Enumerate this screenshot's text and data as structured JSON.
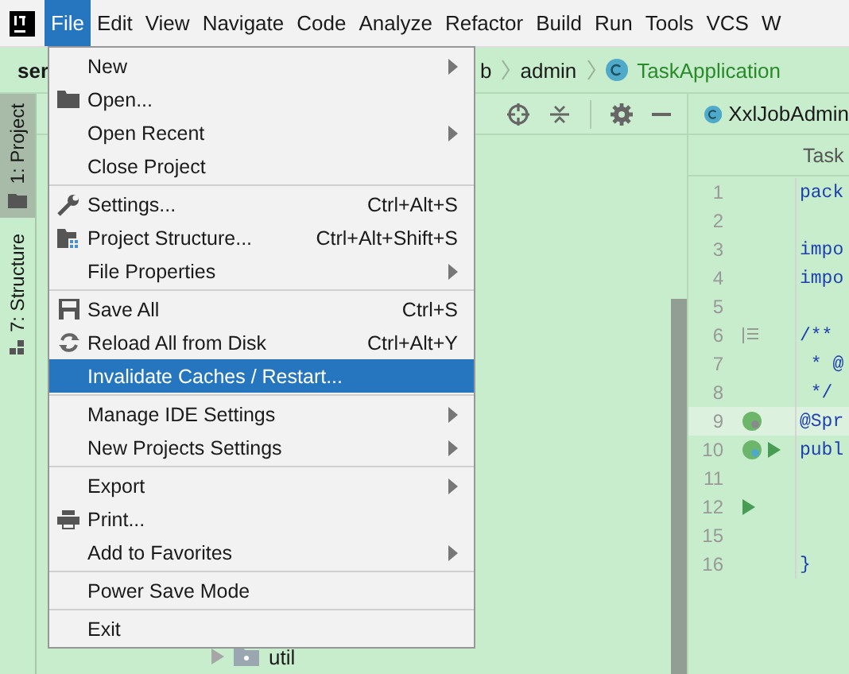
{
  "menu_bar": [
    {
      "label": "File",
      "selected": true
    },
    {
      "label": "Edit",
      "selected": false
    },
    {
      "label": "View",
      "selected": false
    },
    {
      "label": "Navigate",
      "selected": false
    },
    {
      "label": "Code",
      "selected": false
    },
    {
      "label": "Analyze",
      "selected": false
    },
    {
      "label": "Refactor",
      "selected": false
    },
    {
      "label": "Build",
      "selected": false
    },
    {
      "label": "Run",
      "selected": false
    },
    {
      "label": "Tools",
      "selected": false
    },
    {
      "label": "VCS",
      "selected": false
    },
    {
      "label": "W",
      "selected": false
    }
  ],
  "breadcrumb": {
    "project": "ser",
    "items": [
      "b",
      "admin"
    ],
    "class_name": "TaskApplication"
  },
  "tool_tabs": [
    {
      "label": "1: Project",
      "selected": true
    },
    {
      "label": "7: Structure",
      "selected": false
    }
  ],
  "project_tree": {
    "items": [
      {
        "label": "util",
        "expanded": false
      }
    ]
  },
  "editor": {
    "tab": "XxlJobAdmin",
    "path": "Task",
    "lines": [
      {
        "number": "1",
        "code": "pack",
        "current": false
      },
      {
        "number": "2",
        "current": false
      },
      {
        "number": "3",
        "code": "impo",
        "current": false
      },
      {
        "number": "4",
        "code": "impo",
        "current": false
      },
      {
        "number": "5",
        "current": false
      },
      {
        "number": "6",
        "code": "/**",
        "current": false
      },
      {
        "number": "7",
        "code": " * @",
        "current": false
      },
      {
        "number": "8",
        "code": " */",
        "current": false
      },
      {
        "number": "9",
        "code": "@Spr",
        "current": true
      },
      {
        "number": "10",
        "code": "publ",
        "current": false
      },
      {
        "number": "11",
        "current": false
      },
      {
        "number": "12",
        "current": false
      },
      {
        "number": "15",
        "current": false
      },
      {
        "number": "16",
        "code": "}",
        "current": false
      }
    ]
  },
  "file_menu": [
    [
      {
        "label": "New",
        "submenu": true,
        "selected": false
      },
      {
        "label": "Open...",
        "submenu": false,
        "selected": false
      },
      {
        "label": "Open Recent",
        "submenu": true,
        "selected": false
      },
      {
        "label": "Close Project",
        "submenu": false,
        "selected": false
      }
    ],
    [
      {
        "label": "Settings...",
        "shortcut": "Ctrl+Alt+S",
        "submenu": false,
        "selected": false
      },
      {
        "label": "Project Structure...",
        "shortcut": "Ctrl+Alt+Shift+S",
        "submenu": false,
        "selected": false
      },
      {
        "label": "File Properties",
        "submenu": true,
        "selected": false
      }
    ],
    [
      {
        "label": "Save All",
        "shortcut": "Ctrl+S",
        "submenu": false,
        "selected": false
      },
      {
        "label": "Reload All from Disk",
        "shortcut": "Ctrl+Alt+Y",
        "submenu": false,
        "selected": false
      },
      {
        "label": "Invalidate Caches / Restart...",
        "submenu": false,
        "selected": true
      }
    ],
    [
      {
        "label": "Manage IDE Settings",
        "submenu": true,
        "selected": false
      },
      {
        "label": "New Projects Settings",
        "submenu": true,
        "selected": false
      }
    ],
    [
      {
        "label": "Export",
        "submenu": true,
        "selected": false
      },
      {
        "label": "Print...",
        "submenu": false,
        "selected": false
      },
      {
        "label": "Add to Favorites",
        "submenu": true,
        "selected": false
      }
    ],
    [
      {
        "label": "Power Save Mode",
        "submenu": false,
        "selected": false
      }
    ],
    [
      {
        "label": "Exit",
        "submenu": false,
        "selected": false
      }
    ]
  ]
}
